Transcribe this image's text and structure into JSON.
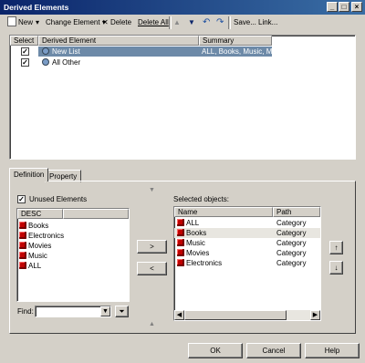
{
  "window": {
    "title": "Derived Elements"
  },
  "toolbar": {
    "new_label": "New",
    "change_element_label": "Change Element",
    "delete_label": "Delete",
    "delete_all_label": "Delete All",
    "save_label": "Save...",
    "link_label": "Link..."
  },
  "derived_table": {
    "headers": {
      "select": "Select",
      "element": "Derived Element",
      "summary": "Summary"
    },
    "rows": [
      {
        "name": "New List",
        "summary": "ALL, Books, Music, M...",
        "checked": true,
        "selected": true
      },
      {
        "name": "All Other",
        "summary": "",
        "checked": true,
        "selected": false
      }
    ]
  },
  "tabs": {
    "definition": "Definition",
    "property": "Property"
  },
  "unused": {
    "checkbox_label": "Unused Elements",
    "checked": true,
    "column_header": "DESC",
    "items": [
      "Books",
      "Electronics",
      "Movies",
      "Music",
      "ALL"
    ],
    "find_label": "Find:",
    "find_value": ""
  },
  "selected_objects": {
    "label": "Selected objects:",
    "headers": {
      "name": "Name",
      "path": "Path"
    },
    "rows": [
      {
        "name": "ALL",
        "path": "Category"
      },
      {
        "name": "Books",
        "path": "Category"
      },
      {
        "name": "Music",
        "path": "Category"
      },
      {
        "name": "Movies",
        "path": "Category"
      },
      {
        "name": "Electronics",
        "path": "Category"
      }
    ]
  },
  "transfer": {
    "add": ">",
    "remove": "<"
  },
  "footer": {
    "ok": "OK",
    "cancel": "Cancel",
    "help": "Help"
  }
}
